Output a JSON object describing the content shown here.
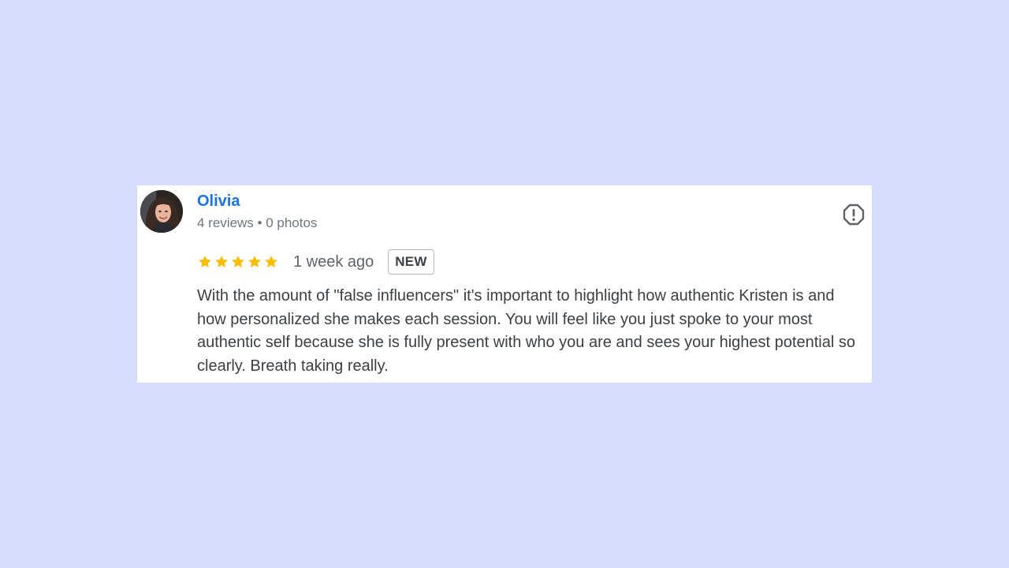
{
  "review": {
    "reviewer": {
      "name": "Olivia",
      "meta": "4 reviews • 0 photos"
    },
    "rating": 5,
    "rating_max": 5,
    "time": "1 week ago",
    "badge": "NEW",
    "text": "With the amount of \"false influencers\" it's important to highlight how authentic Kristen is and how personalized she makes each session. You will feel like you just spoke to your most authentic self because she is fully present with who you are and sees your highest potential so clearly. Breath taking really."
  },
  "colors": {
    "background": "#d6dcfb",
    "card": "#ffffff",
    "name_link": "#1a73e8",
    "star": "#fbbc04",
    "meta_text": "#70757a",
    "body_text": "#3c4043"
  },
  "icons": {
    "report": "report-flag-icon",
    "star": "star-icon"
  }
}
